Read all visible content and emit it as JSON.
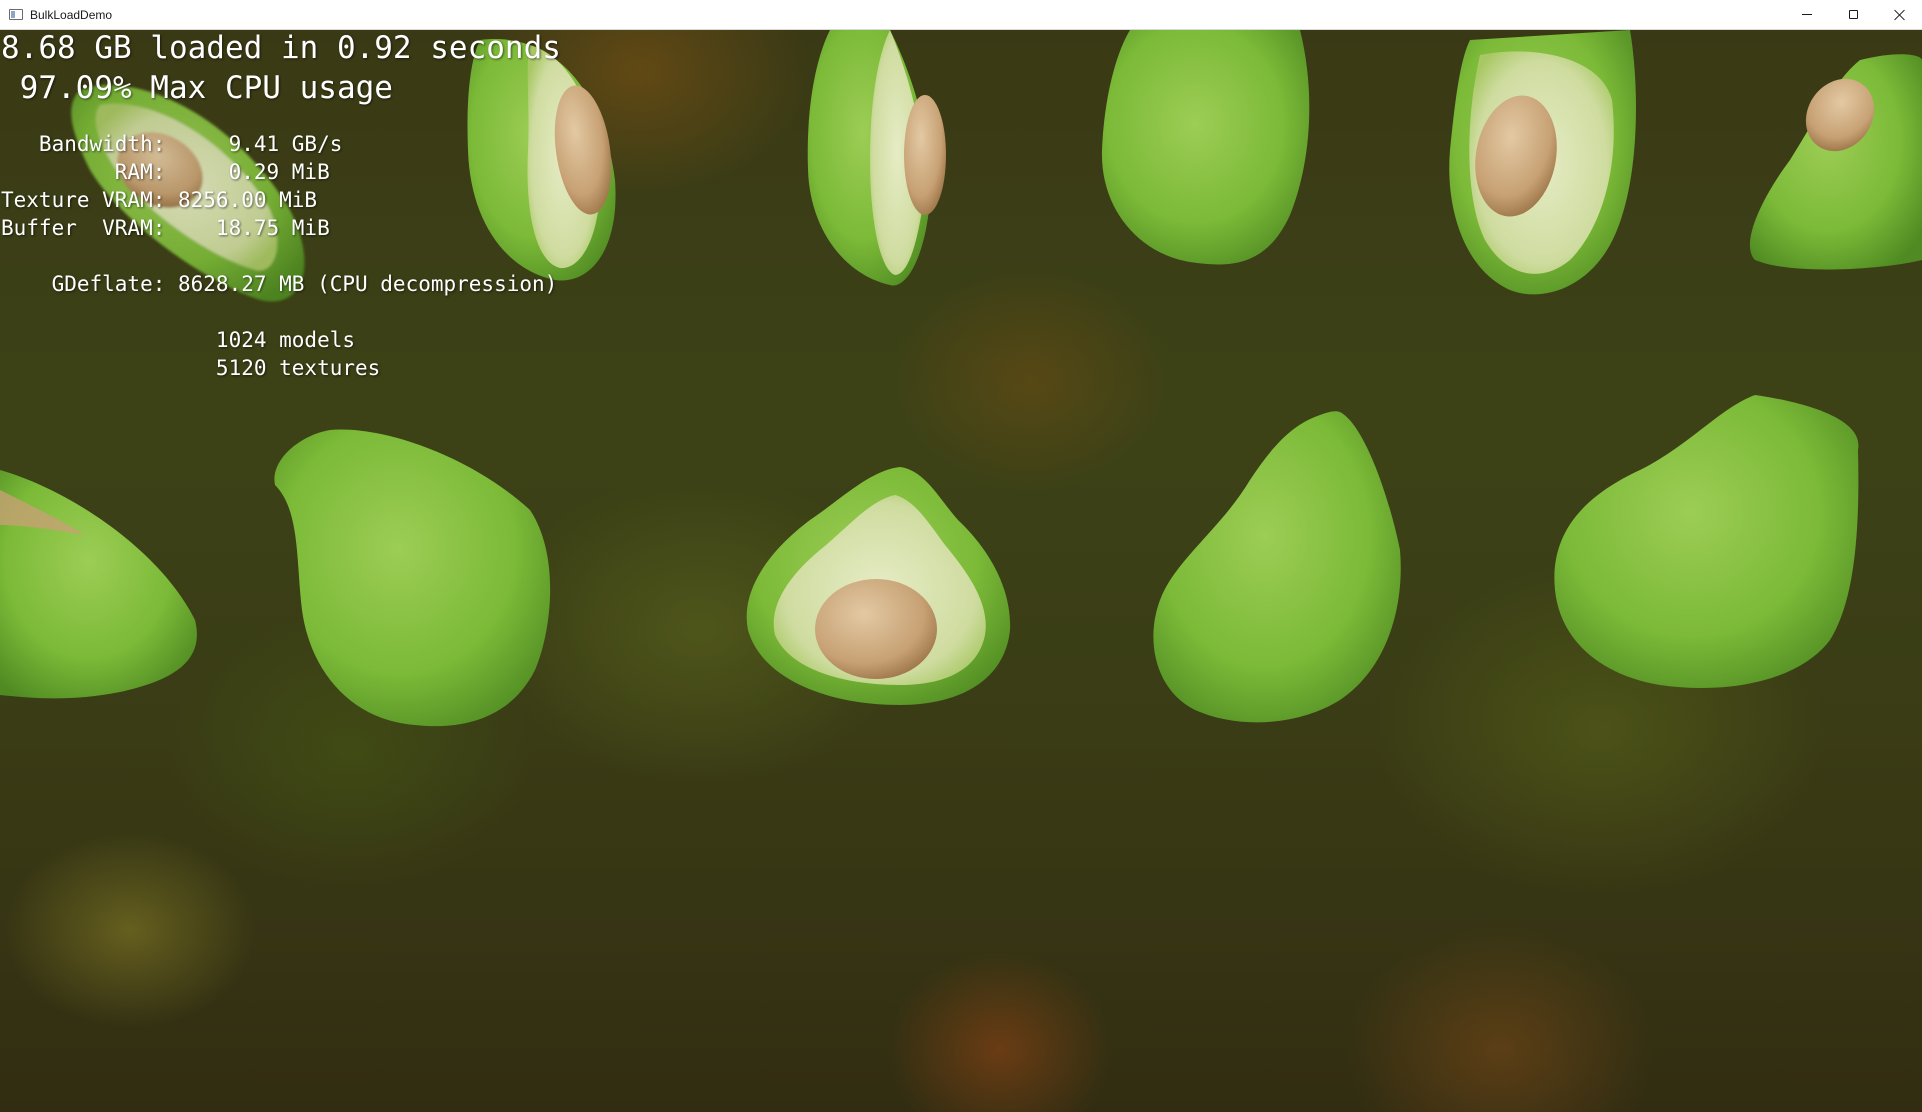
{
  "window": {
    "title": "BulkLoadDemo",
    "app_icon": "window-app-icon",
    "controls": [
      "minimize-icon",
      "maximize-icon",
      "close-icon"
    ]
  },
  "overlay": {
    "loaded_line": "8.68 GB loaded in 0.92 seconds",
    "cpu_line": " 97.09% Max CPU usage",
    "bandwidth_line": "   Bandwidth:     9.41 GB/s",
    "ram_line": "         RAM:     0.29 MiB",
    "texture_vram_line": "Texture VRAM: 8256.00 MiB",
    "buffer_vram_line": "Buffer  VRAM:    18.75 MiB",
    "gdeflate_line": "    GDeflate: 8628.27 MB (CPU decompression)",
    "models_line": "                 1024 models",
    "textures_line": "                 5120 textures"
  },
  "scene": {
    "description_items": [
      "avocado-half-with-pit",
      "avocado-whole"
    ],
    "colors": {
      "skin": "#7fbf3a",
      "skin_dark": "#4f8a22",
      "flesh": "#d9e3b0",
      "pit": "#c9a579",
      "background": "#3b3d16"
    }
  }
}
